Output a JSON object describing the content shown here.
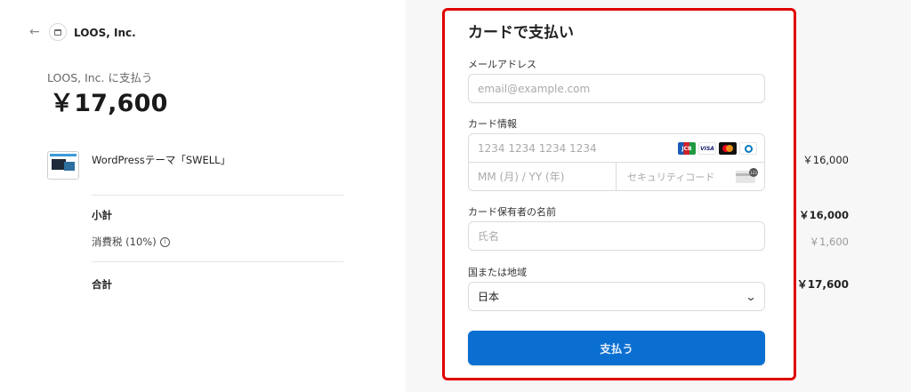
{
  "header": {
    "back_icon": "arrow-left-icon",
    "merchant_logo_icon": "store-icon",
    "merchant_name": "LOOS, Inc."
  },
  "summary": {
    "pay_to_label": "LOOS, Inc. に支払う",
    "total_amount": "￥17,600",
    "items": [
      {
        "name": "WordPressテーマ「SWELL」",
        "price": "￥16,000"
      }
    ],
    "subtotal_label": "小計",
    "subtotal_value": "￥16,000",
    "tax_label": "消費税 (10%)",
    "tax_value": "￥1,600",
    "total_label": "合計",
    "total_value": "￥17,600"
  },
  "form": {
    "title": "カードで支払い",
    "email_label": "メールアドレス",
    "email_placeholder": "email@example.com",
    "card_label": "カード情報",
    "card_number_placeholder": "1234 1234 1234 1234",
    "card_expiry_placeholder": "MM (月) / YY (年)",
    "card_cvc_placeholder": "セキュリティコード",
    "card_brands": [
      "JCB",
      "VISA",
      "Mastercard",
      "Diners Club"
    ],
    "holder_label": "カード保有者の名前",
    "holder_placeholder": "氏名",
    "country_label": "国または地域",
    "country_value": "日本",
    "pay_button_label": "支払う"
  },
  "colors": {
    "highlight_border": "#e00000",
    "pay_button": "#0b6fd2",
    "right_panel_bg": "#f7f7f8"
  }
}
